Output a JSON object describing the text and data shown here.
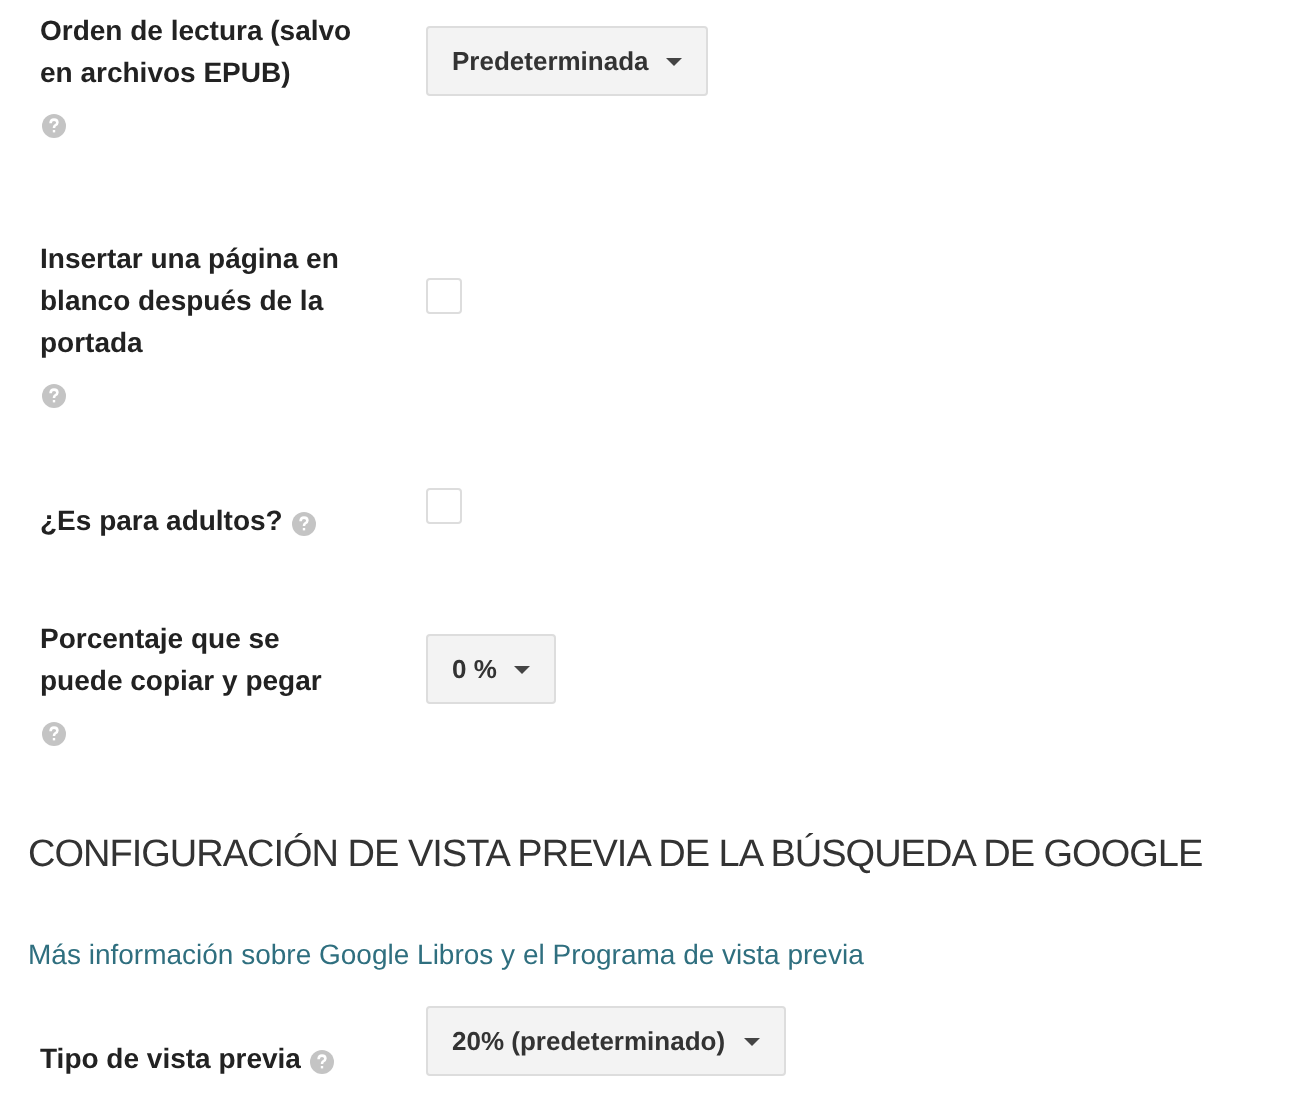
{
  "settings": [
    {
      "label": "Orden de lectura (salvo en archivos EPUB)",
      "help_inline": false,
      "kind": "dropdown",
      "value": "Predeterminada"
    },
    {
      "label": "Insertar una página en blanco después de la portada",
      "help_inline": false,
      "kind": "checkbox",
      "checked": false
    },
    {
      "label": "¿Es para adultos?",
      "help_inline": true,
      "kind": "checkbox",
      "checked": false
    },
    {
      "label": "Porcentaje que se puede copiar y pegar",
      "help_inline": false,
      "kind": "dropdown",
      "value": "0 %"
    }
  ],
  "preview_section": {
    "heading": "CONFIGURACIÓN DE VISTA PREVIA DE LA BÚSQUEDA DE GOOGLE",
    "link": "Más información sobre Google Libros y el Programa de vista previa",
    "settings": [
      {
        "label": "Tipo de vista previa",
        "help_inline": true,
        "kind": "dropdown",
        "value": "20% (predeterminado)"
      }
    ]
  }
}
